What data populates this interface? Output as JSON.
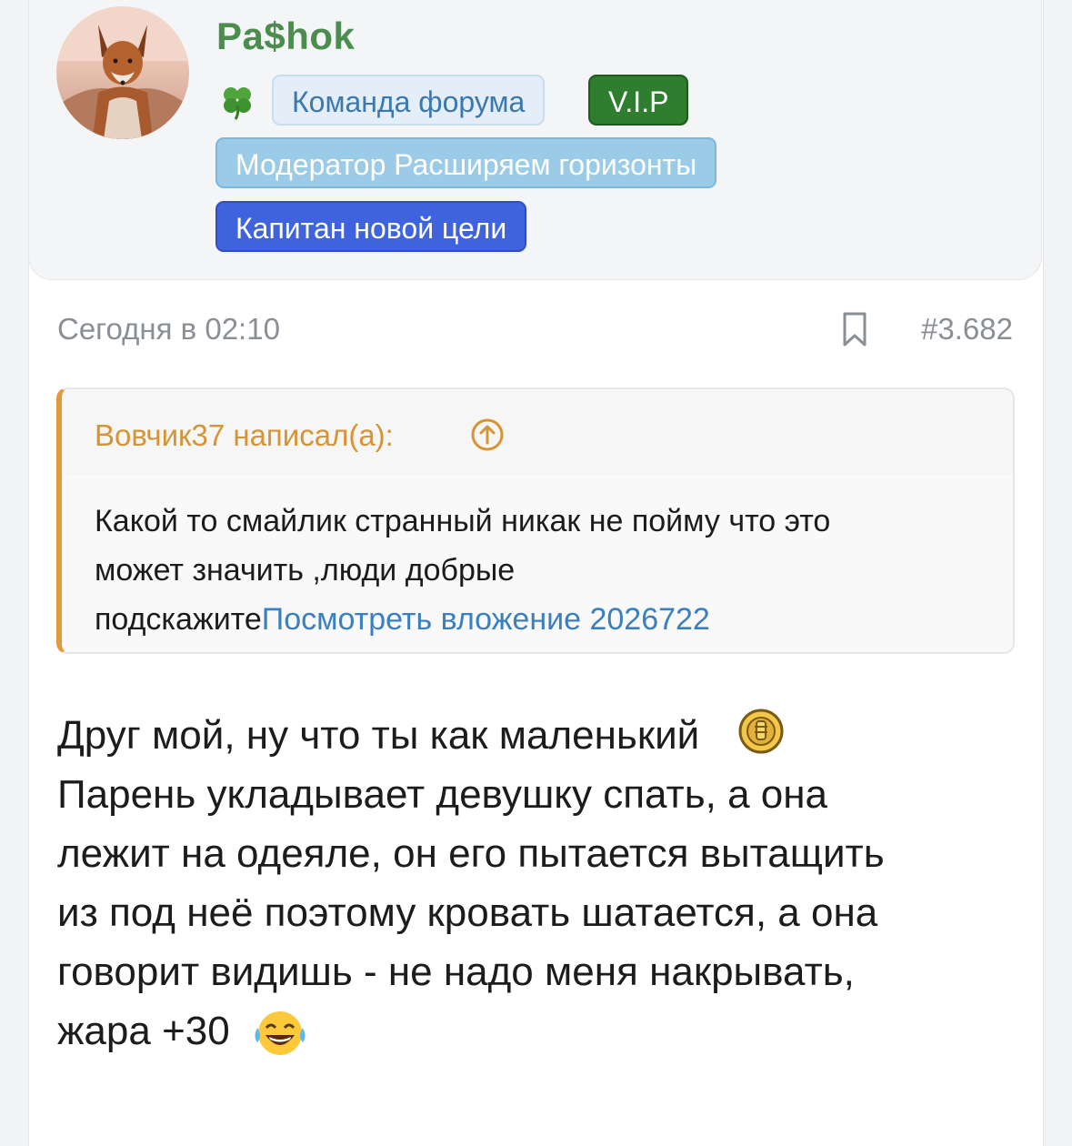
{
  "user": {
    "name": "Pa$hok",
    "badges": {
      "team": "Команда форума",
      "vip": "V.I.P",
      "moderator": "Модератор Расширяем горизонты",
      "captain": "Капитан новой цели"
    },
    "icons": {
      "clover": "four-leaf-clover-icon",
      "avatar": "fox-avatar"
    }
  },
  "post": {
    "date": "Сегодня в 02:10",
    "number": "#3.682",
    "quote": {
      "author": "Вовчик37 написал(а):",
      "text_line1": "Какой то смайлик странный никак не пойму что это",
      "text_line2": "может значить ,люди добрые",
      "text_line3": "подскажите",
      "attachment_link": "Посмотреть вложение 2026722"
    },
    "message": {
      "line1": "Друг мой, ну что ты как маленький",
      "line2": "Парень укладывает девушку спать, а она",
      "line3": "лежит на одеяле, он его пытается вытащить",
      "line4": "из под неё поэтому кровать шатается, а она",
      "line5": "говорит видишь - не надо меня накрывать,",
      "line6": "жара +30"
    }
  },
  "colors": {
    "username": "#4c8c4f",
    "quote_accent": "#e29a3c",
    "link": "#3a7fc0",
    "vip": "#2f7d2f",
    "moderator": "#9ccbe8",
    "captain": "#3e63dc"
  }
}
